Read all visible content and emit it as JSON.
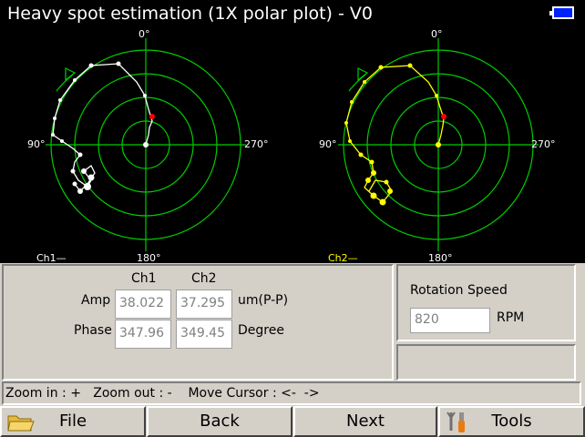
{
  "window": {
    "title": "Heavy spot estimation (1X polar plot) - V0",
    "battery_icon": "battery-icon",
    "battery_color": "#0022ff"
  },
  "plots": {
    "grid_color": "#00cc00",
    "labels": {
      "top": "0°",
      "left": "90°",
      "right": "270°",
      "bottom": "180°"
    },
    "ch1": {
      "legend": "Ch1—",
      "trace_color": "#ffffff",
      "legend_color": "#ffffff",
      "marker_color": "#ff0000"
    },
    "ch2": {
      "legend": "Ch2—",
      "trace_color": "#ffff00",
      "legend_color": "#ffff00",
      "marker_color": "#ff0000"
    }
  },
  "measurements": {
    "col_ch1": "Ch1",
    "col_ch2": "Ch2",
    "amp_label": "Amp",
    "amp_ch1": "38.022",
    "amp_ch2": "37.295",
    "amp_unit": "um(P-P)",
    "phase_label": "Phase",
    "phase_ch1": "347.96",
    "phase_ch2": "349.45",
    "phase_unit": "Degree"
  },
  "rotation": {
    "label": "Rotation Speed",
    "value": "820",
    "unit": "RPM"
  },
  "status": {
    "text": "Zoom in : +   Zoom out : -    Move Cursor : <-  ->"
  },
  "function_keys": {
    "file": "File",
    "back": "Back",
    "next": "Next",
    "tools": "Tools"
  }
}
